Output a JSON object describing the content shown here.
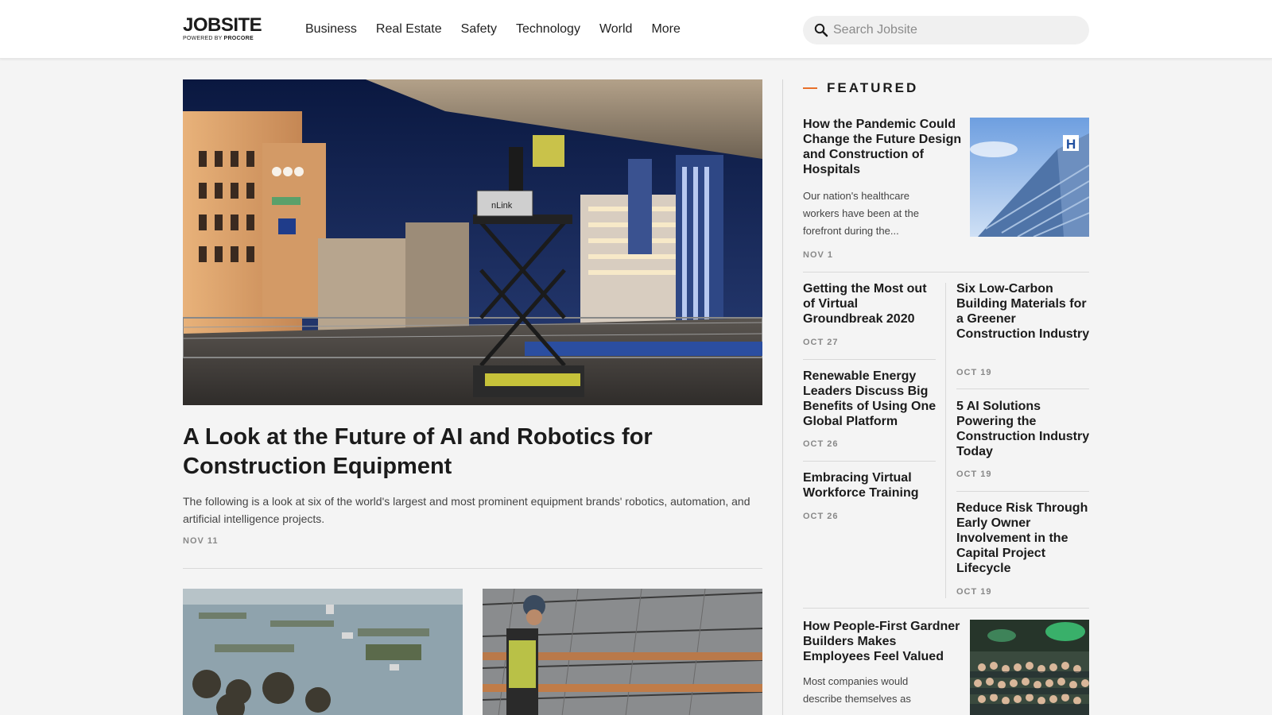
{
  "header": {
    "logo": "JOBSITE",
    "logo_sub_prefix": "POWERED BY",
    "logo_sub_brand": "PROCORE",
    "nav": [
      "Business",
      "Real Estate",
      "Safety",
      "Technology",
      "World",
      "More"
    ],
    "search_placeholder": "Search Jobsite"
  },
  "main": {
    "hero": {
      "title": "A Look at the Future of AI and Robotics for Construction Equipment",
      "description": "The following is a look at six of the world's largest and most prominent equipment brands' robotics, automation, and artificial intelligence projects.",
      "date": "NOV 11",
      "image_label": "nLink"
    }
  },
  "sidebar": {
    "featured_label": "FEATURED",
    "top": {
      "title": "How the Pandemic Could Change the Future Design and Construction of Hospitals",
      "description": "Our nation's healthcare workers have been at the forefront during the...",
      "date": "NOV 1",
      "image_sign": "H"
    },
    "left_items": [
      {
        "title": "Getting the Most out of Virtual Groundbreak 2020",
        "date": "OCT 27"
      },
      {
        "title": "Renewable Energy Leaders Discuss Big Benefits of Using One Global Platform",
        "date": "OCT 26"
      },
      {
        "title": "Embracing Virtual Workforce Training",
        "date": "OCT 26"
      }
    ],
    "right_items": [
      {
        "title": "Six Low-Carbon Building Materials for a Greener Construction Industry",
        "date": "OCT 19"
      },
      {
        "title": "5 AI Solutions Powering the Construction Industry Today",
        "date": "OCT 19"
      },
      {
        "title": "Reduce Risk Through Early Owner Involvement in the Capital Project Lifecycle",
        "date": "OCT 19"
      }
    ],
    "bottom": {
      "title": "How People-First Gardner Builders Makes Employees Feel Valued",
      "description": "Most companies would describe themselves as"
    }
  },
  "colors": {
    "accent": "#e8702a",
    "background": "#f4f4f4",
    "text": "#1b1b1b"
  }
}
